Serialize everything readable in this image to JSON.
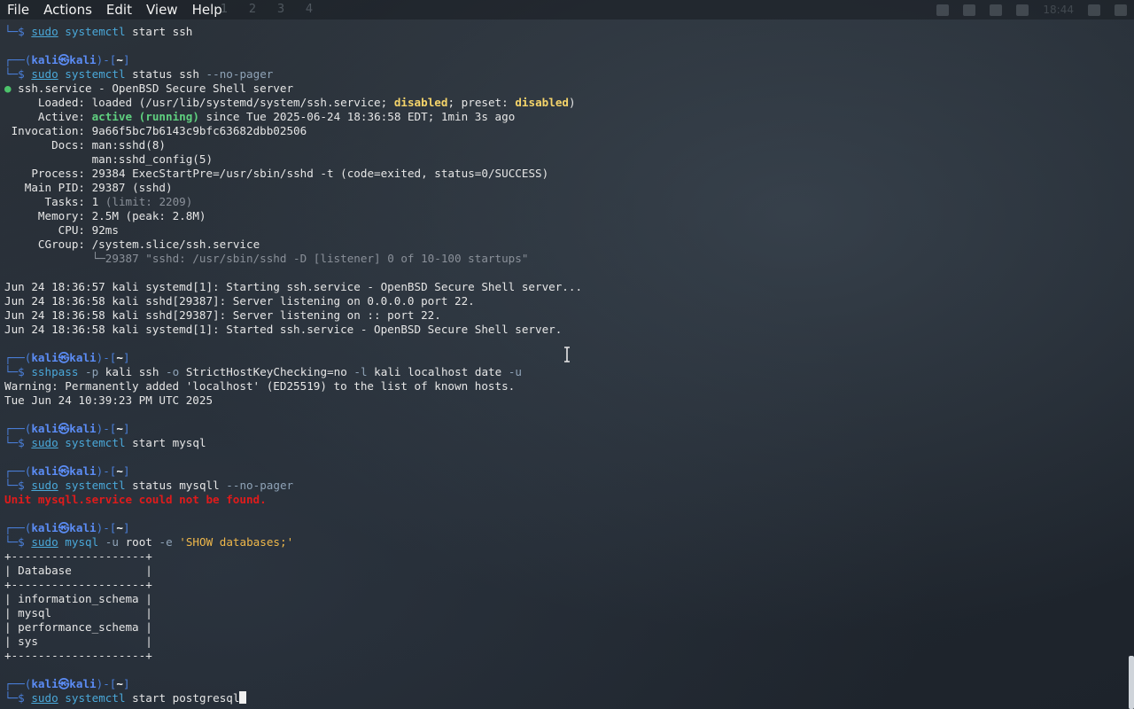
{
  "menu": [
    "File",
    "Actions",
    "Edit",
    "View",
    "Help"
  ],
  "workspaces": [
    "1",
    "2",
    "3",
    "4"
  ],
  "tray": {
    "clock": "18:44"
  },
  "prompt": {
    "user": "kali",
    "at": "㉿",
    "host": "kali",
    "dir": "~"
  },
  "lines": {
    "l0_cmd1": "sudo",
    "l0_cmd2": "systemctl",
    "l0_rest": "start ssh",
    "l1_cmd1": "sudo",
    "l1_cmd2": "systemctl",
    "l1_rest": "status ssh",
    "l1_opt": "--no-pager",
    "svc_title": "ssh.service - OpenBSD Secure Shell server",
    "loaded_label": "Loaded:",
    "loaded_a": "loaded (/usr/lib/systemd/system/ssh.service;",
    "loaded_dis1": "disabled",
    "loaded_b": "; preset:",
    "loaded_dis2": "disabled",
    "loaded_c": ")",
    "active_label": "Active:",
    "active_val": "active (running)",
    "active_rest": "since Tue 2025-06-24 18:36:58 EDT; 1min 3s ago",
    "inv_label": "Invocation:",
    "inv_val": "9a66f5bc7b6143c9bfc63682dbb02506",
    "docs_label": "Docs:",
    "docs_1": "man:sshd(8)",
    "docs_2": "man:sshd_config(5)",
    "proc_label": "Process:",
    "proc_val": "29384 ExecStartPre=/usr/sbin/sshd -t (code=exited, status=0/SUCCESS)",
    "pid_label": "Main PID:",
    "pid_val": "29387 (sshd)",
    "tasks_label": "Tasks:",
    "tasks_val": "1",
    "tasks_lim": "(limit: 2209)",
    "mem_label": "Memory:",
    "mem_val": "2.5M (peak: 2.8M)",
    "cpu_label": "CPU:",
    "cpu_val": "92ms",
    "cg_label": "CGroup:",
    "cg_val": "/system.slice/ssh.service",
    "cg_child": "└─29387 \"sshd: /usr/sbin/sshd -D [listener] 0 of 10-100 startups\"",
    "log1": "Jun 24 18:36:57 kali systemd[1]: Starting ssh.service - OpenBSD Secure Shell server...",
    "log2": "Jun 24 18:36:58 kali sshd[29387]: Server listening on 0.0.0.0 port 22.",
    "log3": "Jun 24 18:36:58 kali sshd[29387]: Server listening on :: port 22.",
    "log4": "Jun 24 18:36:58 kali systemd[1]: Started ssh.service - OpenBSD Secure Shell server.",
    "sp_cmd": "sshpass",
    "sp_o1": "-p",
    "sp_a1": "kali ssh",
    "sp_o2": "-o",
    "sp_a2": "StrictHostKeyChecking=no",
    "sp_o3": "-l",
    "sp_a3": "kali localhost date",
    "sp_o4": "-u",
    "warn": "Warning: Permanently added 'localhost' (ED25519) to the list of known hosts.",
    "date_out": "Tue Jun 24 10:39:23 PM UTC 2025",
    "my_cmd1": "sudo",
    "my_cmd2": "systemctl",
    "my_rest": "start mysql",
    "my2_cmd1": "sudo",
    "my2_cmd2": "systemctl",
    "my2_rest": "status mysqll",
    "my2_opt": "--no-pager",
    "unit_err": "Unit mysqll.service could not be found.",
    "sql_cmd1": "sudo",
    "sql_cmd2": "mysql",
    "sql_o1": "-u",
    "sql_a1": "root",
    "sql_o2": "-e",
    "sql_str": "'SHOW databases;'",
    "tbl_border": "+--------------------+",
    "tbl_head": "| Database           |",
    "tbl_r1": "| information_schema |",
    "tbl_r2": "| mysql              |",
    "tbl_r3": "| performance_schema |",
    "tbl_r4": "| sys                |",
    "pg_cmd1": "sudo",
    "pg_cmd2": "systemctl",
    "pg_rest": "start postgresql"
  }
}
